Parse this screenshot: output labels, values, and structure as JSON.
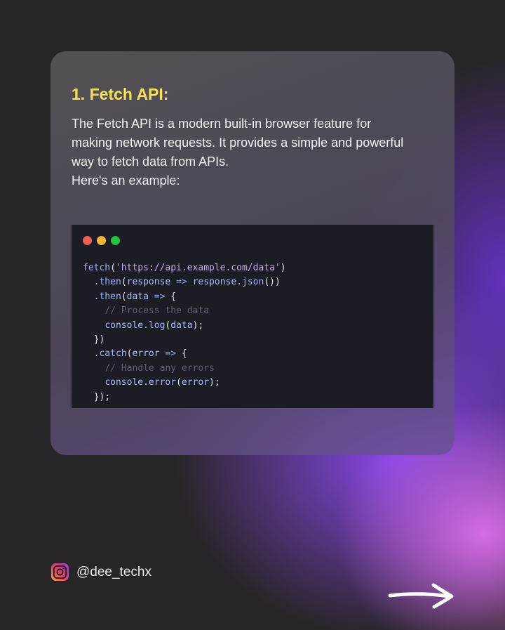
{
  "card": {
    "title": "1. Fetch API:",
    "description": [
      "The Fetch API is a modern built-in browser feature for",
      "making network requests. It provides a simple and powerful",
      "way to fetch data from APIs.",
      "Here's an example:"
    ]
  },
  "code_window": {
    "dot_colors": [
      "#ec5f57",
      "#f3b43c",
      "#26c043"
    ],
    "code": {
      "l1": {
        "fn": "fetch",
        "p1": "(",
        "str": "'https://api.example.com/data'",
        "p2": ")"
      },
      "l2": {
        "fn": ".then",
        "p1": "(",
        "a": "response",
        "op": " => ",
        "b": "response",
        "c": ".json",
        "p2": "())"
      },
      "l3": {
        "fn": ".then",
        "p1": "(",
        "a": "data",
        "op": " => ",
        "p2": "{"
      },
      "l4": {
        "cmt": "// Process the data"
      },
      "l5": {
        "a": "console",
        "b": ".log",
        "p1": "(",
        "c": "data",
        "p2": ");"
      },
      "l6": {
        "p": "})"
      },
      "l7": {
        "fn": ".catch",
        "p1": "(",
        "a": "error",
        "op": " => ",
        "p2": "{"
      },
      "l8": {
        "cmt": "// Handle any errors"
      },
      "l9": {
        "a": "console",
        "b": ".error",
        "p1": "(",
        "c": "error",
        "p2": ");"
      },
      "l10": {
        "p": "});"
      }
    }
  },
  "footer": {
    "handle": "@dee_techx",
    "instagram_icon": "instagram-icon",
    "next_icon": "arrow-right-icon"
  },
  "colors": {
    "title": "#f5e15c",
    "accent_purple": "#8c48f0",
    "accent_pink": "#dc6eeb"
  }
}
